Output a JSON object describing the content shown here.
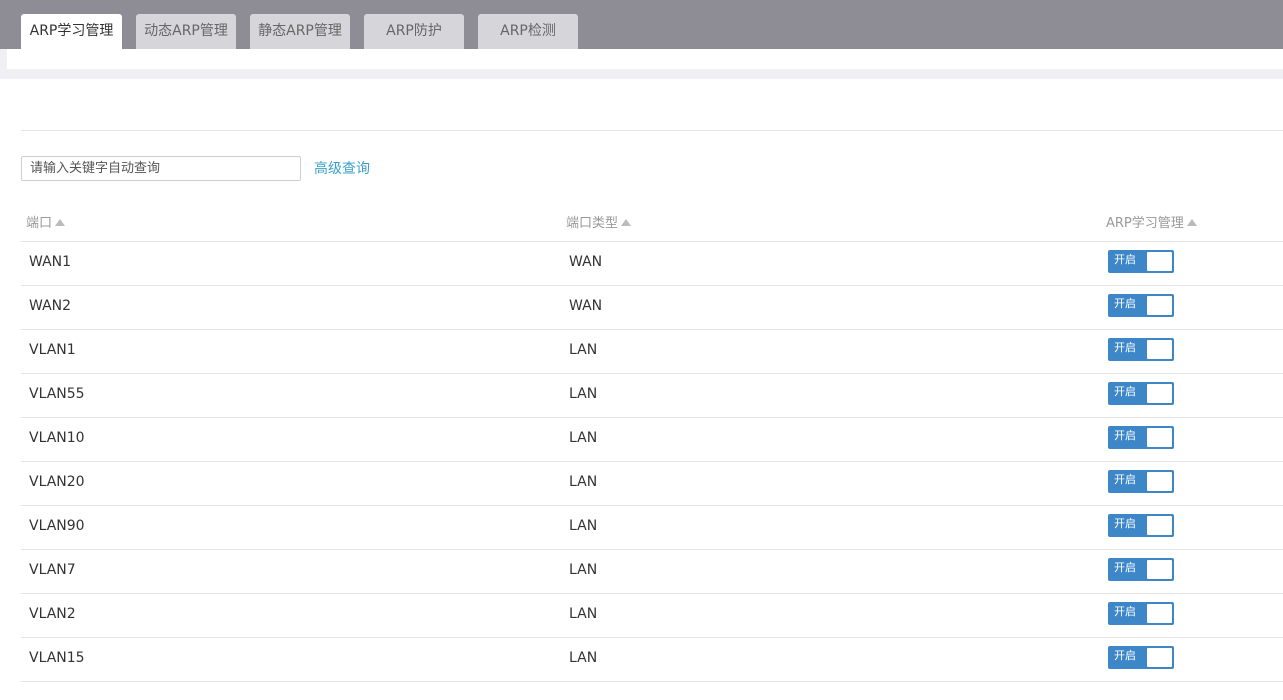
{
  "tabs": [
    {
      "label": "ARP学习管理",
      "active": true
    },
    {
      "label": "动态ARP管理",
      "active": false
    },
    {
      "label": "静态ARP管理",
      "active": false
    },
    {
      "label": "ARP防护",
      "active": false
    },
    {
      "label": "ARP检测",
      "active": false
    }
  ],
  "search": {
    "placeholder": "请输入关键字自动查询",
    "advanced_label": "高级查询"
  },
  "table": {
    "columns": [
      "端口",
      "端口类型",
      "ARP学习管理"
    ],
    "rows": [
      {
        "port": "WAN1",
        "type": "WAN",
        "status": "开启"
      },
      {
        "port": "WAN2",
        "type": "WAN",
        "status": "开启"
      },
      {
        "port": "VLAN1",
        "type": "LAN",
        "status": "开启"
      },
      {
        "port": "VLAN55",
        "type": "LAN",
        "status": "开启"
      },
      {
        "port": "VLAN10",
        "type": "LAN",
        "status": "开启"
      },
      {
        "port": "VLAN20",
        "type": "LAN",
        "status": "开启"
      },
      {
        "port": "VLAN90",
        "type": "LAN",
        "status": "开启"
      },
      {
        "port": "VLAN7",
        "type": "LAN",
        "status": "开启"
      },
      {
        "port": "VLAN2",
        "type": "LAN",
        "status": "开启"
      },
      {
        "port": "VLAN15",
        "type": "LAN",
        "status": "开启"
      }
    ]
  },
  "colors": {
    "accent": "#3d87c9",
    "tabbar": "#8e8c95",
    "link": "#3aa3c7"
  },
  "icons": {
    "sort": "sort-asc-icon"
  }
}
